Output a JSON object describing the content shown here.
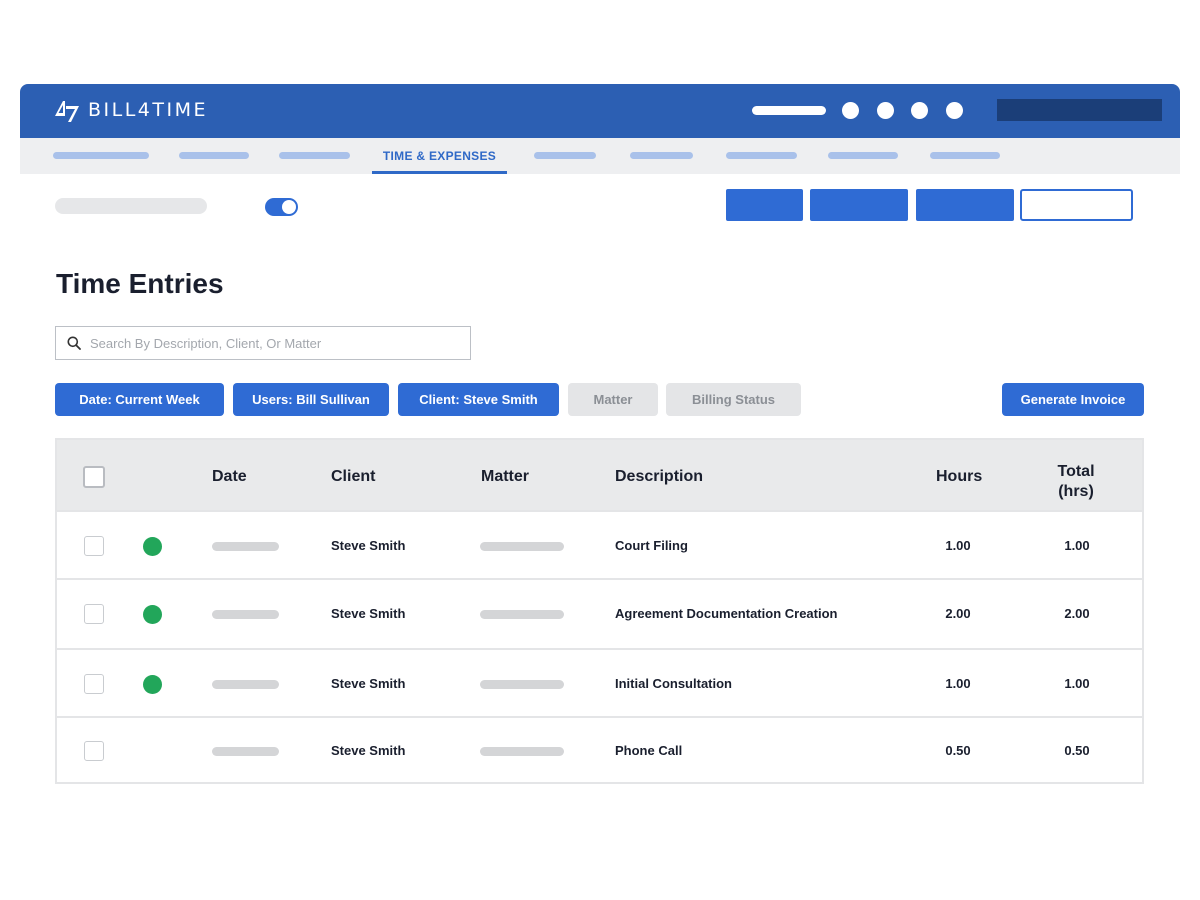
{
  "app": {
    "brand": "BILL4TIME",
    "colors": {
      "header": "#2c5fb3",
      "accent": "#2f6bd4",
      "status_green": "#22a65a",
      "chip_inactive": "#e4e5e7"
    },
    "icons": {
      "logo": "bill4time-logo-icon",
      "search": "search-icon"
    }
  },
  "nav": {
    "active_tab": "TIME & EXPENSES"
  },
  "page": {
    "title": "Time Entries"
  },
  "search": {
    "placeholder": "Search By Description, Client, Or Matter",
    "value": ""
  },
  "filters": {
    "date": "Date: Current Week",
    "users": "Users: Bill Sullivan",
    "client": "Client: Steve Smith",
    "matter": "Matter",
    "billing_status": "Billing Status",
    "generate_invoice": "Generate Invoice"
  },
  "table": {
    "columns": {
      "date": "Date",
      "client": "Client",
      "matter": "Matter",
      "description": "Description",
      "hours": "Hours",
      "total_line1": "Total",
      "total_line2": "(hrs)"
    },
    "rows": [
      {
        "client": "Steve Smith",
        "description": "Court Filing",
        "hours": "1.00",
        "total": "1.00",
        "status": "green"
      },
      {
        "client": "Steve Smith",
        "description": "Agreement Documentation Creation",
        "hours": "2.00",
        "total": "2.00",
        "status": "green"
      },
      {
        "client": "Steve Smith",
        "description": "Initial Consultation",
        "hours": "1.00",
        "total": "1.00",
        "status": "green"
      },
      {
        "client": "Steve Smith",
        "description": "Phone Call",
        "hours": "0.50",
        "total": "0.50",
        "status": "none"
      }
    ]
  }
}
